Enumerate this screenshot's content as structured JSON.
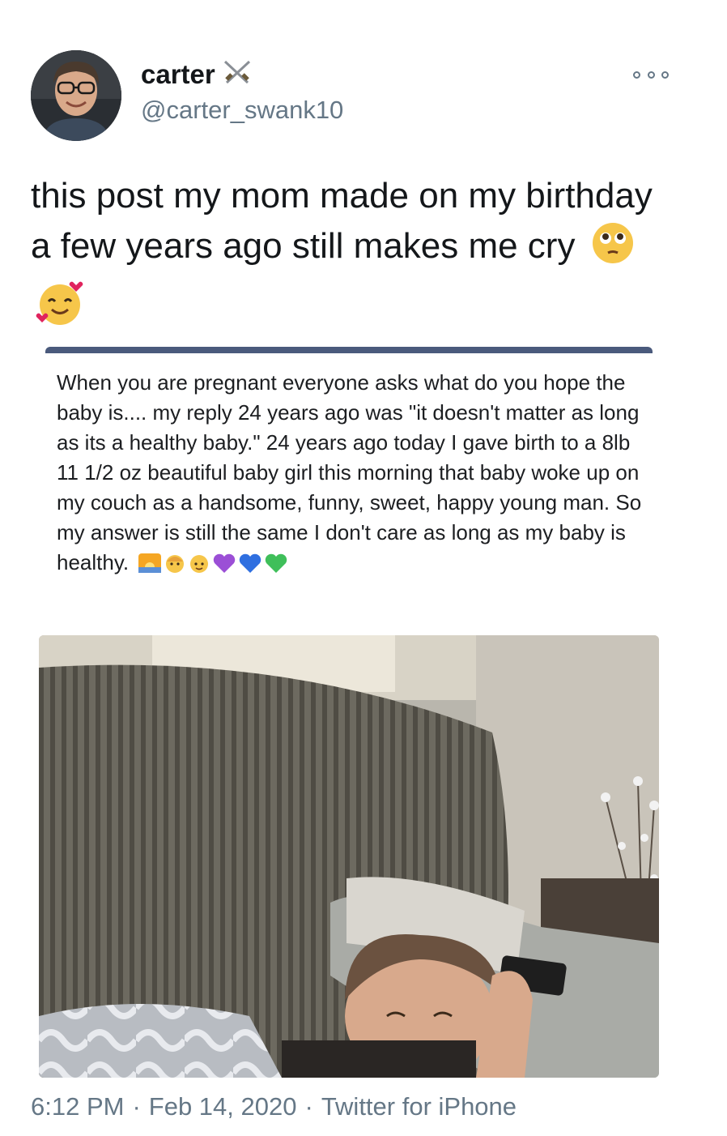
{
  "author": {
    "display_name": "carter",
    "handle": "@carter_swank10"
  },
  "tweet": {
    "text": "this post my mom made on my birthday a few years ago still makes me cry",
    "trailing_emojis": [
      "face-holding-back-tears-emoji",
      "smiling-face-with-hearts-emoji"
    ]
  },
  "embedded_post": {
    "text": "When you are pregnant everyone asks what do you hope the baby is.... my reply 24 years ago was \"it doesn't matter as long as its a healthy baby.\" 24 years ago today I gave birth to a  8lb 11 1/2 oz beautiful baby girl this morning that baby woke up on my couch as a handsome, funny, sweet, happy young man. So my answer is still the same I don't care as long as my baby is healthy.",
    "trailing_emojis": [
      "sunrise-emoji",
      "baby-girl-emoji",
      "baby-boy-emoji",
      "purple-heart-emoji",
      "blue-heart-emoji",
      "green-heart-emoji"
    ],
    "photo_description_icon": "sleeping-on-couch-photo"
  },
  "footer": {
    "time": "6:12 PM",
    "separator1": "·",
    "date": "Feb 14, 2020",
    "separator2": "·",
    "source": "Twitter for iPhone"
  },
  "colors": {
    "text_primary": "#14171a",
    "text_secondary": "#657786",
    "embed_bar": "#4a5a7c"
  }
}
